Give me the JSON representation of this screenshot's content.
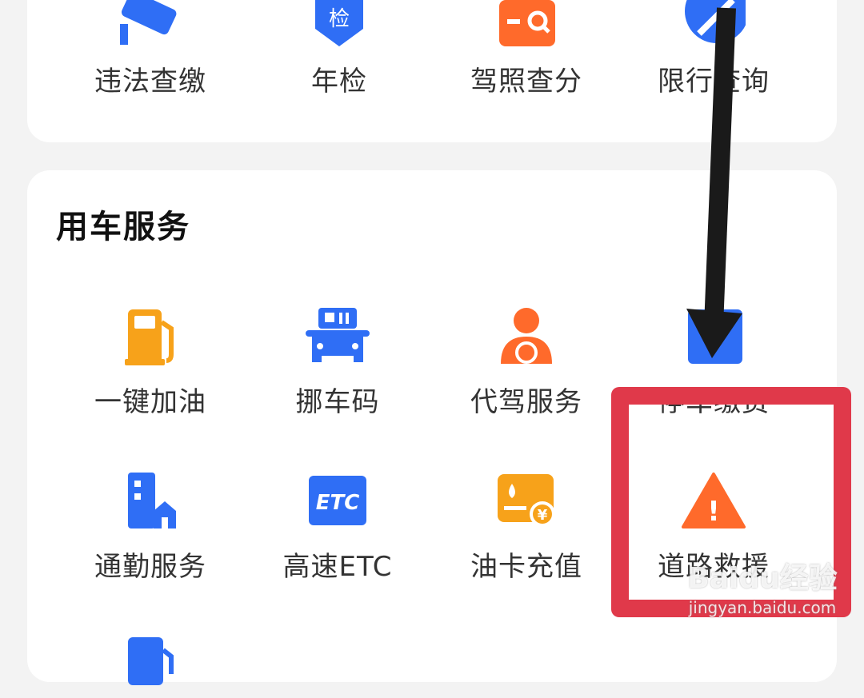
{
  "top_services": [
    {
      "label": "违法查缴",
      "icon": "camera-icon"
    },
    {
      "label": "年检",
      "icon": "inspection-badge-icon",
      "icon_text": "检"
    },
    {
      "label": "驾照查分",
      "icon": "license-search-icon"
    },
    {
      "label": "限行查询",
      "icon": "restriction-icon"
    }
  ],
  "car_services": {
    "title": "用车服务",
    "items": [
      {
        "label": "一键加油",
        "icon": "fuel-pump-icon"
      },
      {
        "label": "挪车码",
        "icon": "move-car-icon"
      },
      {
        "label": "代驾服务",
        "icon": "chauffeur-icon"
      },
      {
        "label": "停车缴费",
        "icon": "parking-icon"
      },
      {
        "label": "通勤服务",
        "icon": "commute-icon"
      },
      {
        "label": "高速ETC",
        "icon": "etc-icon",
        "icon_text": "ETC"
      },
      {
        "label": "油卡充值",
        "icon": "fuel-card-icon",
        "icon_text": "¥"
      },
      {
        "label": "道路救援",
        "icon": "warning-triangle-icon",
        "icon_text": "!"
      }
    ]
  },
  "annotation": {
    "highlight_color": "#e0394a",
    "arrow_color": "#1a1a1a"
  },
  "watermark": {
    "brand": "Baidu经验",
    "url": "jingyan.baidu.com"
  },
  "colors": {
    "blue": "#2f6ef5",
    "orange": "#ff6a2b",
    "amber": "#f7a21a",
    "text": "#333333"
  }
}
